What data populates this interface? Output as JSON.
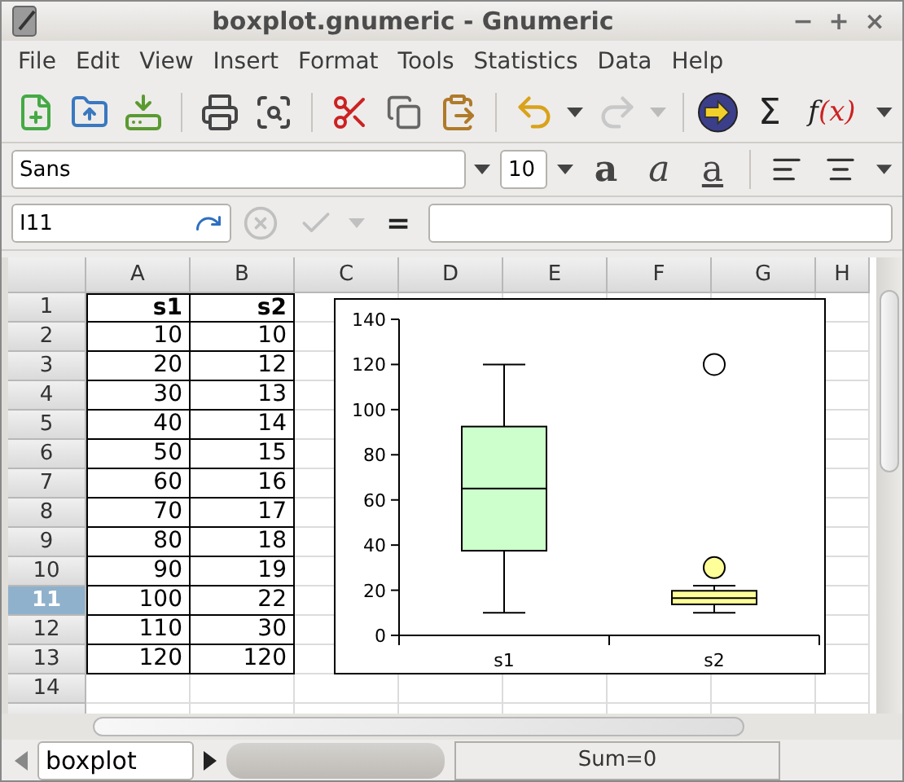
{
  "window": {
    "title": "boxplot.gnumeric - Gnumeric",
    "controls": [
      "−",
      "+",
      "×"
    ]
  },
  "menu": [
    "File",
    "Edit",
    "View",
    "Insert",
    "Format",
    "Tools",
    "Statistics",
    "Data",
    "Help"
  ],
  "toolbar": {
    "redo": {
      "disabled": true
    },
    "sum_label": "Σ",
    "function_label": "f(x)"
  },
  "format_bar": {
    "font": "Sans",
    "size": "10",
    "bold_glyph": "a",
    "italic_glyph": "a",
    "underline_glyph": "a"
  },
  "formula_bar": {
    "cell_ref": "I11",
    "actions_disabled": true,
    "equals": "="
  },
  "columns": [
    {
      "label": "A",
      "selected": false
    },
    {
      "label": "B",
      "selected": false
    },
    {
      "label": "C",
      "selected": false
    },
    {
      "label": "D",
      "selected": false
    },
    {
      "label": "E",
      "selected": false
    },
    {
      "label": "F",
      "selected": false
    },
    {
      "label": "G",
      "selected": false
    },
    {
      "label": "H",
      "selected": false
    }
  ],
  "rows": [
    {
      "header": "1",
      "selected": false,
      "kind": "header",
      "cells": [
        "s1",
        "s2"
      ]
    },
    {
      "header": "2",
      "selected": false,
      "kind": "data",
      "cells": [
        "10",
        "10"
      ]
    },
    {
      "header": "3",
      "selected": false,
      "kind": "data",
      "cells": [
        "20",
        "12"
      ]
    },
    {
      "header": "4",
      "selected": false,
      "kind": "data",
      "cells": [
        "30",
        "13"
      ]
    },
    {
      "header": "5",
      "selected": false,
      "kind": "data",
      "cells": [
        "40",
        "14"
      ]
    },
    {
      "header": "6",
      "selected": false,
      "kind": "data",
      "cells": [
        "50",
        "15"
      ]
    },
    {
      "header": "7",
      "selected": false,
      "kind": "data",
      "cells": [
        "60",
        "16"
      ]
    },
    {
      "header": "8",
      "selected": false,
      "kind": "data",
      "cells": [
        "70",
        "17"
      ]
    },
    {
      "header": "9",
      "selected": false,
      "kind": "data",
      "cells": [
        "80",
        "18"
      ]
    },
    {
      "header": "10",
      "selected": false,
      "kind": "data",
      "cells": [
        "90",
        "19"
      ]
    },
    {
      "header": "11",
      "selected": true,
      "kind": "data",
      "cells": [
        "100",
        "22"
      ]
    },
    {
      "header": "12",
      "selected": false,
      "kind": "data",
      "cells": [
        "110",
        "30"
      ]
    },
    {
      "header": "13",
      "selected": false,
      "kind": "data",
      "cells": [
        "120",
        "120"
      ]
    },
    {
      "header": "14",
      "selected": false,
      "kind": "empty",
      "cells": []
    },
    {
      "selected": false,
      "kind": "empty",
      "cells": []
    }
  ],
  "chart": {
    "boxes": [
      {
        "color": "#ccffcc"
      },
      {
        "color": "#ffff99"
      }
    ],
    "y_tick_labels": [
      "140",
      "120",
      "100",
      "80",
      "60",
      "40",
      "20",
      "0"
    ],
    "category_labels": [
      "s1",
      "s2"
    ]
  },
  "sheet_tab": "boxplot",
  "status": "Sum=0"
}
